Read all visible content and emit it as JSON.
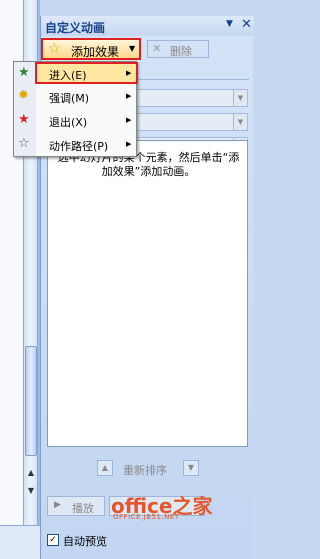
{
  "pane": {
    "title": "自定义动画"
  },
  "toolbar": {
    "add_effect_label": "添加效果",
    "remove_label": "删除"
  },
  "menu": {
    "items": [
      {
        "label": "进入(E)",
        "icon": "enter-star-icon"
      },
      {
        "label": "强调(M)",
        "icon": "emphasis-star-icon"
      },
      {
        "label": "退出(X)",
        "icon": "exit-star-icon"
      },
      {
        "label": "动作路径(P)",
        "icon": "motion-path-star-icon"
      }
    ]
  },
  "listbox": {
    "message": "选中幻灯片的某个元素，然后单击“添加效果”添加动画。"
  },
  "reorder": {
    "label": "重新排序"
  },
  "footer": {
    "play_label": "播放",
    "autopreview_label": "自动预览",
    "autopreview_checked": true
  },
  "watermark": {
    "brand": "office之家",
    "url": "OFFICE.JB51.NET"
  },
  "colors": {
    "highlight_border": "#e02020",
    "title_text": "#15428b",
    "watermark": "#e4572e"
  }
}
